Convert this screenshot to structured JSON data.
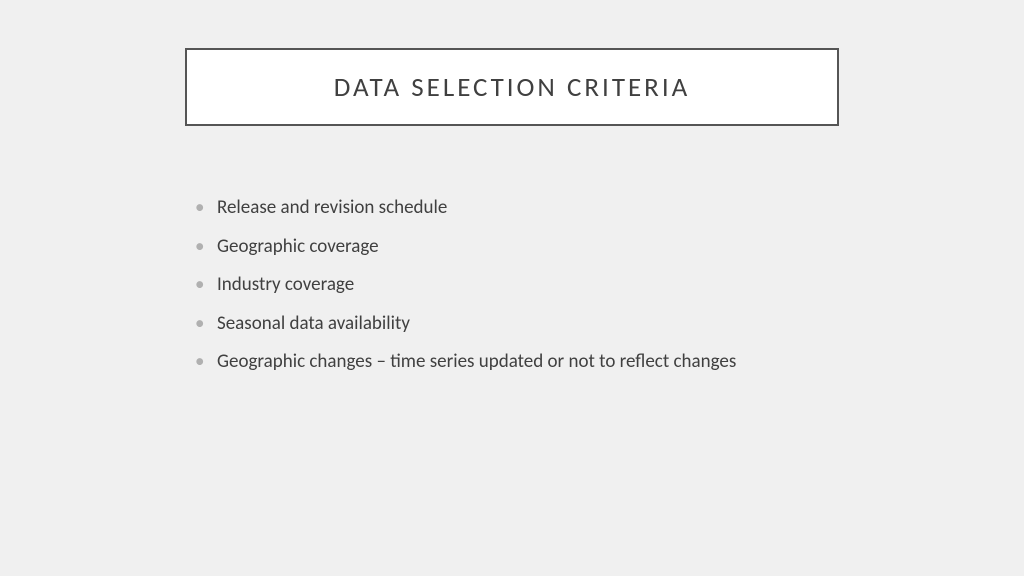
{
  "slide": {
    "title": "DATA SELECTION CRITERIA",
    "bullets": [
      "Release and revision schedule",
      "Geographic coverage",
      "Industry coverage",
      "Seasonal data availability",
      "Geographic changes – time series updated or not to reflect changes"
    ]
  }
}
